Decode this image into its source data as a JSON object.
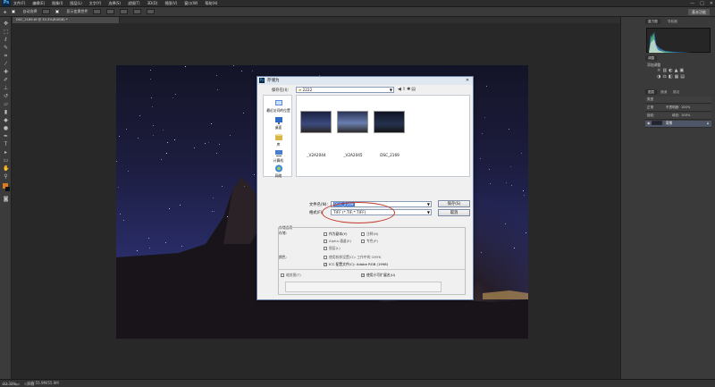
{
  "app": {
    "logo": "Ps",
    "menu": [
      "文件(F)",
      "编辑(E)",
      "图像(I)",
      "图层(L)",
      "文字(Y)",
      "选择(S)",
      "滤镜(T)",
      "3D(D)",
      "视图(V)",
      "窗口(W)",
      "帮助(H)"
    ],
    "window_controls": [
      "—",
      "□",
      "✕"
    ]
  },
  "options_bar": {
    "tool": "自动选择",
    "items": [
      "显示变换控件"
    ],
    "workspace": "基本功能"
  },
  "document_tab": "DSC_2169.tif @ 33.3%(RGB/8) *",
  "status": {
    "zoom": "33.33%",
    "doc": "文档:55.9M/55.9M",
    "bottom_left": "Mini Bridge",
    "bottom_left2": "时间轴"
  },
  "right_panel": {
    "tabs_top": [
      "直方图",
      "导航器"
    ],
    "adjust_tab": "调整",
    "adjust_title": "添加调整",
    "layers_tabs": [
      "图层",
      "通道",
      "路径"
    ],
    "layer_kind": "类型",
    "blend_mode": "正常",
    "opacity_label": "不透明度:",
    "opacity_value": "100%",
    "lock_label": "锁定:",
    "fill_label": "填充:",
    "fill_value": "100%",
    "layer_name": "背景"
  },
  "dialog": {
    "title": "存储为",
    "save_in_label": "保存在(I):",
    "save_in_value": "2222",
    "places": [
      "最近访问的位置",
      "桌面",
      "库",
      "计算机",
      "网络"
    ],
    "files": [
      "_V2A2044",
      "_V2A2045",
      "DSC_2169"
    ],
    "filename_label": "文件名(N):",
    "filename_value": "DSC_2169",
    "format_label": "格式(F):",
    "format_value": "TIFF (*.TIF;*.TIFF)",
    "save_button": "保存(S)",
    "cancel_button": "取消",
    "save_options_title": "存储选项",
    "storage_label": "存储:",
    "as_copy": "作为副本(Y)",
    "notes": "注释(N)",
    "alpha": "Alpha 通道(E)",
    "spot": "专色(P)",
    "layers": "图层(L)",
    "color_label": "颜色:",
    "use_proof": "使用校样设置(O): 工作中的 CMYK",
    "icc": "ICC 配置文件(C): Adobe RGB (1998)",
    "thumbnail": "缩览图(T)",
    "lowercase_ext": "使用小写扩展名(U)"
  },
  "colors": {
    "accent_ring": "#c2382a",
    "dialog_bg": "#f0f0f0",
    "ps_blue": "#5bb0f0"
  }
}
